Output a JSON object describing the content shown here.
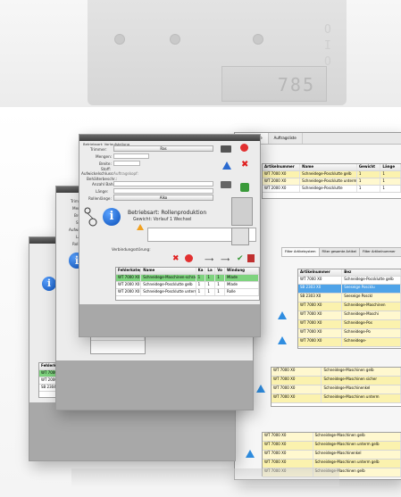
{
  "device": {
    "display_value": "785",
    "side_glyphs": [
      "O",
      "I",
      "O"
    ]
  },
  "front_window": {
    "header_left": "Betriebsart: Vorlaufstellung",
    "form_labels": [
      "Trimmer:",
      "Mengen:",
      "Breite:",
      "Stoff:",
      "Aufwickelschluss:",
      "Auftragskopf:",
      "Behälterbeschr.:",
      "Anzahl Bahnen:",
      "Länge:",
      "Rollenlänge:"
    ],
    "form_values": [
      "Ras",
      "",
      "",
      "",
      "",
      "",
      "",
      "",
      "",
      "Alko"
    ],
    "status_title": "Betriebsart: Rollenproduktion",
    "status_sub": "Gewicht: Vorlauf 1 Wechsel",
    "actions_label": "Verbindungsstörung:",
    "table_headers": [
      "Fehlerkategorie",
      "Name",
      "Ka",
      "La",
      "Vo",
      "Windung"
    ],
    "table_rows": [
      [
        "WT 7000 X0",
        "Schneidege-Maschinen-schrank",
        "1",
        "1",
        "1",
        "Mlade"
      ],
      [
        "WT 2000 X0",
        "Schneidege-Poscklutte gelb",
        "1",
        "1",
        "1",
        "Mlade"
      ],
      [
        "WT 2000 X0",
        "Schneidege-Poscklutte unterm gelb",
        "1",
        "1",
        "1",
        "Rolle"
      ]
    ]
  },
  "mid_window": {
    "labels": [
      "Trimmer:",
      "Mengen:",
      "Breite:",
      "Stoff:",
      "Aufwickel:",
      "Länge:",
      "Rollenlänge:"
    ],
    "first_col": [
      "WT 7000 X0",
      "WT 2000 X0",
      "SB 2304 X0"
    ]
  },
  "back_window": {
    "first_col": [
      "Fehlerkategorie",
      "WT 7000 X0",
      "WT 2000 X0",
      "SB 2304 X0"
    ]
  },
  "right_window": {
    "tabs": [
      "Materialliste",
      "Auftragsliste"
    ],
    "table1_headers": [
      "Artikelnummer",
      "Name",
      "Gewicht",
      "Länge"
    ],
    "table1_rows": [
      [
        "WT 7000 X0",
        "Schneidege-Poscklutte gelb",
        "1",
        "1"
      ],
      [
        "WT 2000 X0",
        "Schneidege-Poscklutte unterm",
        "1",
        "1"
      ],
      [
        "WT 2000 X0",
        "Schneidege-Poscklutte",
        "1",
        "1"
      ]
    ],
    "filter_tabs": [
      "Filter Artikelsystem",
      "Filter gesamte Artikel",
      "Filter Artikelnummer"
    ],
    "table2_headers": [
      "Artikelnummer",
      "Bez"
    ],
    "table2_rows": [
      [
        "WT 7000 X0",
        "Schneidege-Pocsklutte gelb"
      ],
      [
        "SB 2303 X0",
        "Seeseige Poscklu"
      ],
      [
        "SB 2303 X0",
        "Seeseige Posckl"
      ],
      [
        "WT 7000 X0",
        "Schneidege-Maschinen"
      ],
      [
        "WT 7000 X0",
        "Schneidege-Maschi"
      ],
      [
        "WT 7000 X0",
        "Schneidege-Pos"
      ],
      [
        "WT 7000 X0",
        "Schneidege-Po"
      ],
      [
        "WT 7000 X0",
        "Schneidege-"
      ]
    ],
    "table3_rows": [
      [
        "WT 7000 X0",
        "Schneidege-Maschinen gelb"
      ],
      [
        "WT 7000 X0",
        "Schneidege-Maschinen sicher"
      ],
      [
        "WT 7000 X0",
        "Schneidege-Maschinenkel"
      ],
      [
        "WT 7000 X0",
        "Schneidege-Maschinen unterm"
      ],
      [
        "WT 7000 X0",
        "Schneidege-Maschinen gelb"
      ]
    ],
    "table4_rows": [
      [
        "WT 7000 X0",
        "Schneidege-Maschinen gelb"
      ],
      [
        "WT 7000 X0",
        "Schneidege-Maschinen unterm gelb"
      ],
      [
        "WT 7000 X0",
        "Schneidege-Maschinenkel"
      ],
      [
        "WT 7000 X0",
        "Schneidege-Maschinen unterm gelb"
      ],
      [
        "WT 7000 X0",
        "Schneidege-Maschinen gelb"
      ]
    ]
  }
}
